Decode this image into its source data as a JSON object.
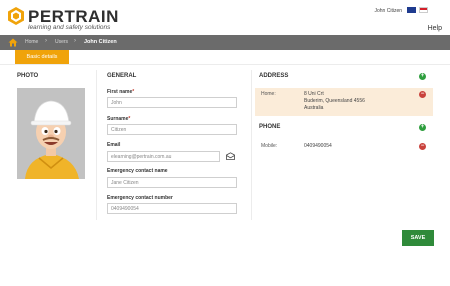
{
  "header": {
    "brand": "PERTRAIN",
    "tagline": "learning and safety solutions",
    "user_name": "John Citizen",
    "help_label": "Help"
  },
  "breadcrumb": {
    "items": [
      "Home",
      "Users"
    ],
    "current": "John Citizen"
  },
  "tabs": {
    "active": "Basic details"
  },
  "photo": {
    "title": "PHOTO"
  },
  "general": {
    "title": "GENERAL",
    "first_name": {
      "label": "First name",
      "required_mark": "*",
      "value": "John"
    },
    "surname": {
      "label": "Surname",
      "required_mark": "*",
      "value": "Citizen"
    },
    "email": {
      "label": "Email",
      "value": "elearning@pertrain.com.au"
    },
    "emergency_name": {
      "label": "Emergency contact name",
      "value": "Jane Citizen"
    },
    "emergency_number": {
      "label": "Emergency contact number",
      "value": "0409490054"
    }
  },
  "address": {
    "title": "ADDRESS",
    "items": [
      {
        "label": "Home:",
        "line1": "8 Uni Crt",
        "line2": "Buderim, Queensland 4556",
        "line3": "Australia"
      }
    ]
  },
  "phone": {
    "title": "PHONE",
    "items": [
      {
        "label": "Mobile:",
        "value": "0409490054"
      }
    ]
  },
  "actions": {
    "save_label": "SAVE",
    "add_symbol": "+",
    "remove_symbol": "−"
  },
  "colors": {
    "accent": "#f0a30a",
    "bar": "#6b6b6b",
    "save": "#2f8a3a",
    "add": "#2e9e3e",
    "remove": "#c9423c"
  }
}
